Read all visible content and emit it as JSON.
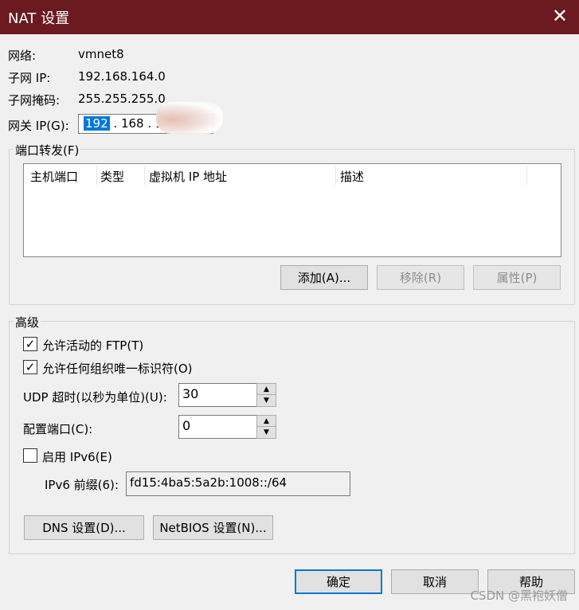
{
  "window": {
    "title": "NAT 设置",
    "close_glyph": "✕"
  },
  "info": {
    "network_label": "网络:",
    "network_value": "vmnet8",
    "subnet_ip_label": "子网 IP:",
    "subnet_ip_value": "192.168.164.0",
    "subnet_mask_label": "子网掩码:",
    "subnet_mask_value": "255.255.255.0",
    "gateway_label": "网关 IP(G):",
    "gateway_octet1": "192",
    "gateway_rest": " . 168 . 1"
  },
  "port_forwarding": {
    "legend": "端口转发(F)",
    "columns": [
      "主机端口",
      "类型",
      "虚拟机 IP 地址",
      "描述"
    ],
    "rows": [],
    "add_button": "添加(A)...",
    "remove_button": "移除(R)",
    "properties_button": "属性(P)"
  },
  "advanced": {
    "legend": "高级",
    "allow_active_ftp": {
      "label": "允许活动的 FTP(T)",
      "checked": true
    },
    "allow_any_oui": {
      "label": "允许任何组织唯一标识符(O)",
      "checked": true
    },
    "udp_timeout_label": "UDP 超时(以秒为单位)(U):",
    "udp_timeout_value": "30",
    "config_port_label": "配置端口(C):",
    "config_port_value": "0",
    "enable_ipv6": {
      "label": "启用 IPv6(E)",
      "checked": false
    },
    "ipv6_prefix_label": "IPv6 前缀(6):",
    "ipv6_prefix_value": "fd15:4ba5:5a2b:1008::/64",
    "dns_button": "DNS 设置(D)...",
    "netbios_button": "NetBIOS 设置(N)..."
  },
  "footer": {
    "ok_button": "确定",
    "cancel_button": "取消",
    "help_button": "帮助"
  },
  "watermark": "CSDN @黑袍妖僧",
  "colors": {
    "titlebar": "#6b1a1f",
    "selection": "#0078d7",
    "focus_border": "#0078d7"
  }
}
